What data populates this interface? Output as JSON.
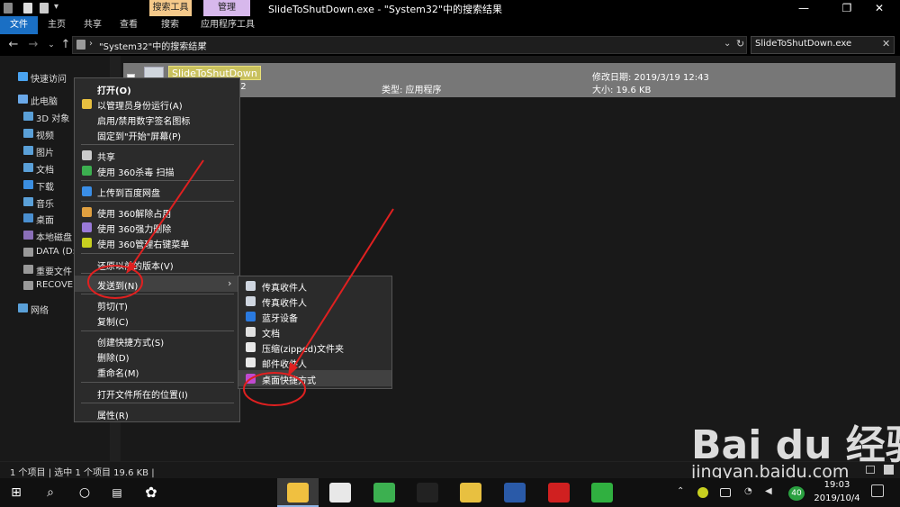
{
  "window": {
    "title": "SlideToShutDown.exe - \"System32\"中的搜索结果",
    "context_tab_search": "搜索工具",
    "context_tab_manage": "管理",
    "controls": [
      "—",
      "❐",
      "✕"
    ]
  },
  "ribbon": {
    "tabs": [
      "文件",
      "主页",
      "共享",
      "查看",
      "搜索",
      "应用程序工具"
    ]
  },
  "address": {
    "path": "\"System32\"中的搜索结果",
    "search_value": "SlideToShutDown.exe"
  },
  "nav": {
    "items": [
      {
        "label": "快速访问",
        "icon": "star-icon",
        "color": "#4aa3f0"
      },
      {
        "label": "此电脑",
        "icon": "pc-icon",
        "color": "#6aa8e8"
      },
      {
        "label": "3D 对象",
        "icon": "folder-3d-icon",
        "color": "#5aa0d8"
      },
      {
        "label": "视频",
        "icon": "folder-video-icon",
        "color": "#5aa0d8"
      },
      {
        "label": "图片",
        "icon": "folder-pictures-icon",
        "color": "#5aa0d8"
      },
      {
        "label": "文档",
        "icon": "folder-documents-icon",
        "color": "#5aa0d8"
      },
      {
        "label": "下载",
        "icon": "folder-downloads-icon",
        "color": "#3b8ee0"
      },
      {
        "label": "音乐",
        "icon": "folder-music-icon",
        "color": "#5aa0d8"
      },
      {
        "label": "桌面",
        "icon": "folder-desktop-icon",
        "color": "#4a8fd0"
      },
      {
        "label": "本地磁盘 (C",
        "icon": "drive-icon",
        "color": "#8a6fb8"
      },
      {
        "label": "DATA (D:",
        "icon": "drive-icon",
        "color": "#999999"
      },
      {
        "label": "重要文件 (",
        "icon": "drive-icon",
        "color": "#999999"
      },
      {
        "label": "RECOVER",
        "icon": "drive-icon",
        "color": "#999999"
      },
      {
        "label": "网络",
        "icon": "network-icon",
        "color": "#5aa0d8"
      }
    ]
  },
  "file": {
    "name": "SlideToShutDown",
    "path": "em32",
    "type": "类型: 应用程序",
    "modified": "修改日期: 2019/3/19 12:43",
    "size": "大小: 19.6 KB"
  },
  "status": {
    "text": "1 个项目  |  选中 1 个项目  19.6 KB  |"
  },
  "context_menu": {
    "items": [
      {
        "label": "打开(O)",
        "icon": "",
        "bold": true
      },
      {
        "label": "以管理员身份运行(A)",
        "icon": "shield-icon",
        "color": "#e8c040"
      },
      {
        "label": "启用/禁用数字签名图标",
        "icon": ""
      },
      {
        "label": "固定到\"开始\"屏幕(P)",
        "icon": ""
      },
      {
        "label": "共享",
        "icon": "share-icon",
        "color": "#cccccc"
      },
      {
        "label": "使用 360杀毒 扫描",
        "icon": "360-antivirus-icon",
        "color": "#3cb050"
      },
      {
        "label": "上传到百度网盘",
        "icon": "baidu-netdisk-icon",
        "color": "#3a8ee6"
      },
      {
        "label": "使用 360解除占用",
        "icon": "360-unlock-icon",
        "color": "#e0a040"
      },
      {
        "label": "使用 360强力删除",
        "icon": "360-delete-icon",
        "color": "#9a7ad8"
      },
      {
        "label": "使用 360管理右键菜单",
        "icon": "360-menu-icon",
        "color": "#c8d020"
      },
      {
        "label": "还原以前的版本(V)",
        "icon": ""
      },
      {
        "label": "发送到(N)",
        "icon": ""
      },
      {
        "label": "剪切(T)",
        "icon": ""
      },
      {
        "label": "复制(C)",
        "icon": ""
      },
      {
        "label": "创建快捷方式(S)",
        "icon": ""
      },
      {
        "label": "删除(D)",
        "icon": ""
      },
      {
        "label": "重命名(M)",
        "icon": ""
      },
      {
        "label": "打开文件所在的位置(I)",
        "icon": ""
      },
      {
        "label": "属性(R)",
        "icon": ""
      }
    ],
    "submenu_arrow": "›"
  },
  "send_to_menu": {
    "items": [
      {
        "label": "传真收件人",
        "icon": "fax-icon",
        "color": "#cfd6e0"
      },
      {
        "label": "传真收件人",
        "icon": "fax-icon",
        "color": "#cfd6e0"
      },
      {
        "label": "蓝牙设备",
        "icon": "bluetooth-icon",
        "color": "#2a7ae0"
      },
      {
        "label": "文档",
        "icon": "documents-icon",
        "color": "#e0e0e0"
      },
      {
        "label": "压缩(zipped)文件夹",
        "icon": "zip-folder-icon",
        "color": "#e8e8e8"
      },
      {
        "label": "邮件收件人",
        "icon": "mail-icon",
        "color": "#e8e8e8"
      },
      {
        "label": "桌面快捷方式",
        "icon": "desktop-shortcut-icon",
        "color": "#c04ad0"
      }
    ]
  },
  "watermark": {
    "logo": "Bai du 经验",
    "url": "jingyan.baidu.com"
  },
  "taskbar": {
    "time": "19:03",
    "date": "2019/10/4",
    "badge": "40",
    "apps": [
      {
        "icon": "file-explorer-icon",
        "color": "#f0c040"
      },
      {
        "icon": "store-icon",
        "color": "#e8e8e8"
      },
      {
        "icon": "360-browser-icon",
        "color": "#3cb050"
      },
      {
        "icon": "qq-icon",
        "color": "#222222"
      },
      {
        "icon": "baidu-netdisk-icon",
        "color": "#e8c040"
      },
      {
        "icon": "tools-icon",
        "color": "#2a5aa8"
      },
      {
        "icon": "wps-icon",
        "color": "#d02020"
      },
      {
        "icon": "wechat-icon",
        "color": "#30b040"
      }
    ]
  }
}
